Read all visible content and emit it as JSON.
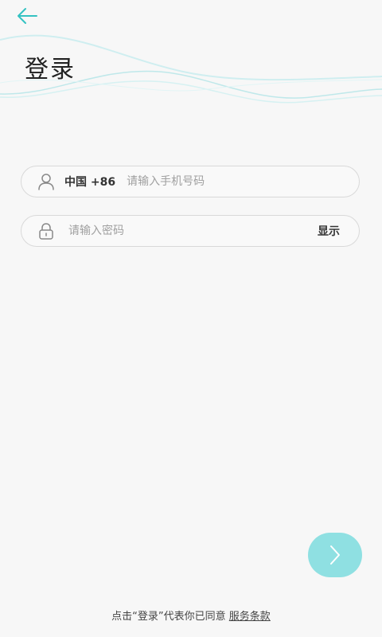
{
  "header": {
    "back_icon": "arrow-left-icon",
    "title": "登录"
  },
  "form": {
    "phone": {
      "icon": "user-icon",
      "country_code": "中国 +86",
      "placeholder": "请输入手机号码",
      "value": ""
    },
    "password": {
      "icon": "lock-icon",
      "placeholder": "请输入密码",
      "value": "",
      "show_label": "显示"
    }
  },
  "next_button": {
    "icon": "chevron-right-icon"
  },
  "footer": {
    "text": "点击“登录”代表你已同意",
    "link_text": "服务条款"
  },
  "colors": {
    "accent": "#34c2c2",
    "next_button": "#8fe0e2",
    "wave": "#bfe8ea",
    "background": "#f7f7f7"
  }
}
